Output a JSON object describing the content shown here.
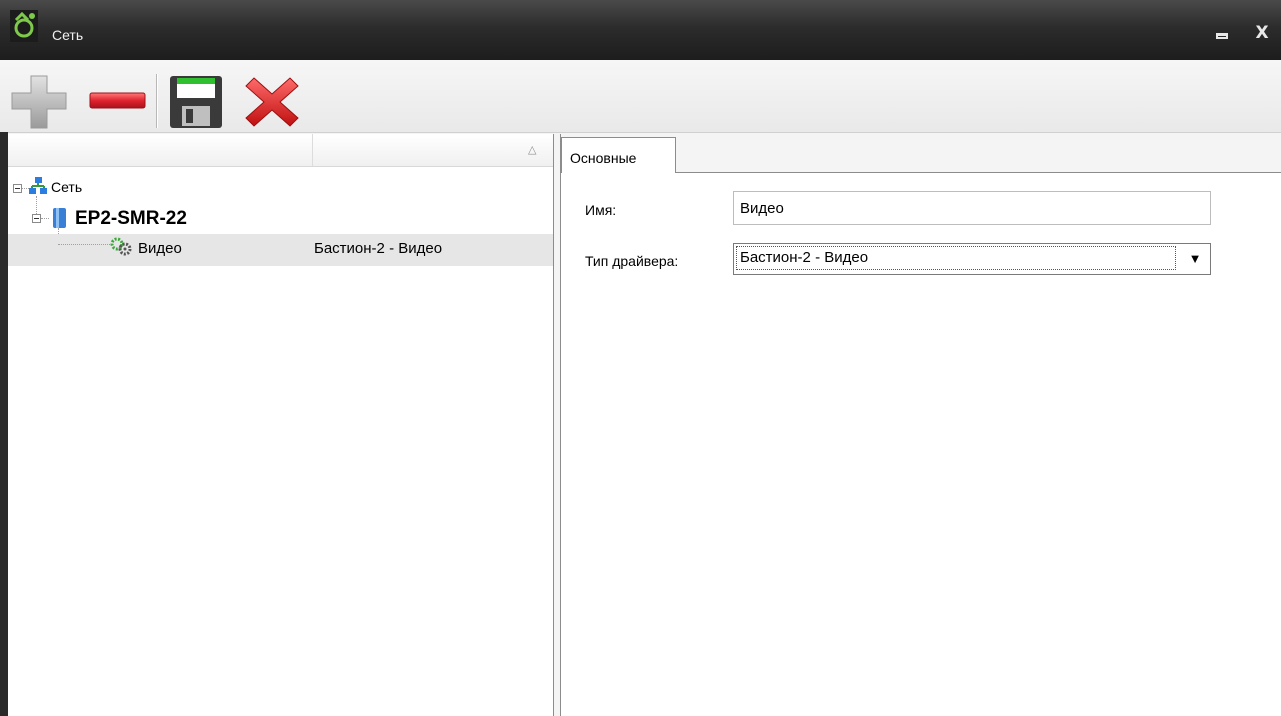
{
  "window": {
    "title": "Сеть",
    "minimize_glyph": "",
    "close_glyph": "X"
  },
  "toolbar": {
    "icons": [
      "add-icon",
      "remove-icon",
      "save-icon",
      "cancel-icon"
    ]
  },
  "tree": {
    "columns": [
      "",
      ""
    ],
    "nodes": [
      {
        "label": "Сеть",
        "icon": "network-icon",
        "value": ""
      },
      {
        "label": "EP2-SMR-22",
        "icon": "server-icon",
        "value": ""
      },
      {
        "label": "Видео",
        "icon": "gears-icon",
        "value": "Бастион-2 - Видео"
      }
    ]
  },
  "tabs": [
    {
      "label": "Основные"
    }
  ],
  "form": {
    "name_label": "Имя:",
    "name_value": "Видео",
    "driver_label": "Тип драйвера:",
    "driver_value": "Бастион-2 - Видео"
  },
  "colors": {
    "titlebar": "#2c2c2c",
    "panel_bg": "#ffffff",
    "selected_row": "#e6e6e6",
    "add_icon": "#b0b0b0",
    "remove_icon": "#e0232f",
    "cancel_icon": "#e02020",
    "save_icon_top": "#2fbf2f"
  }
}
